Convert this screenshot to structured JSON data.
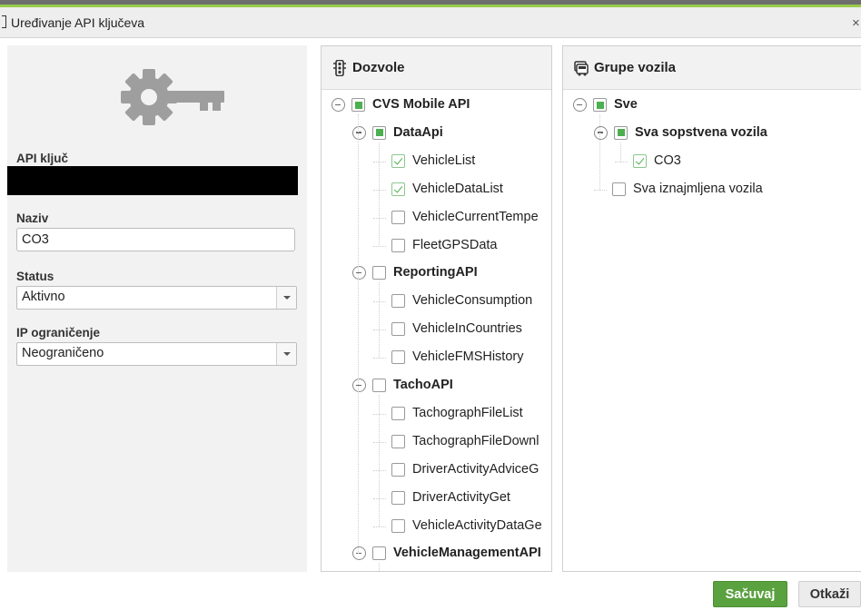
{
  "dialog": {
    "title": "Uređivanje API ključeva",
    "close_glyph": "×"
  },
  "form": {
    "api_key_label": "API ključ",
    "name_label": "Naziv",
    "name_value": "CO3",
    "status_label": "Status",
    "status_value": "Aktivno",
    "ip_label": "IP ograničenje",
    "ip_value": "Neograničeno"
  },
  "permissions": {
    "title": "Dozvole",
    "icon": "traffic-light-icon",
    "nodes": [
      {
        "label": "CVS Mobile API",
        "level": 0,
        "state": "partial",
        "expandable": true,
        "bold": true
      },
      {
        "label": "DataApi",
        "level": 1,
        "state": "partial",
        "expandable": true,
        "bold": true
      },
      {
        "label": "VehicleList",
        "level": 2,
        "state": "checked",
        "expandable": false,
        "bold": false
      },
      {
        "label": "VehicleDataList",
        "level": 2,
        "state": "checked",
        "expandable": false,
        "bold": false
      },
      {
        "label": "VehicleCurrentTempe",
        "level": 2,
        "state": "unchecked",
        "expandable": false,
        "bold": false
      },
      {
        "label": "FleetGPSData",
        "level": 2,
        "state": "unchecked",
        "expandable": false,
        "bold": false
      },
      {
        "label": "ReportingAPI",
        "level": 1,
        "state": "unchecked",
        "expandable": true,
        "bold": true
      },
      {
        "label": "VehicleConsumption",
        "level": 2,
        "state": "unchecked",
        "expandable": false,
        "bold": false
      },
      {
        "label": "VehicleInCountries",
        "level": 2,
        "state": "unchecked",
        "expandable": false,
        "bold": false
      },
      {
        "label": "VehicleFMSHistory",
        "level": 2,
        "state": "unchecked",
        "expandable": false,
        "bold": false
      },
      {
        "label": "TachoAPI",
        "level": 1,
        "state": "unchecked",
        "expandable": true,
        "bold": true
      },
      {
        "label": "TachographFileList",
        "level": 2,
        "state": "unchecked",
        "expandable": false,
        "bold": false
      },
      {
        "label": "TachographFileDownl",
        "level": 2,
        "state": "unchecked",
        "expandable": false,
        "bold": false
      },
      {
        "label": "DriverActivityAdviceG",
        "level": 2,
        "state": "unchecked",
        "expandable": false,
        "bold": false
      },
      {
        "label": "DriverActivityGet",
        "level": 2,
        "state": "unchecked",
        "expandable": false,
        "bold": false
      },
      {
        "label": "VehicleActivityDataGe",
        "level": 2,
        "state": "unchecked",
        "expandable": false,
        "bold": false
      },
      {
        "label": "VehicleManagementAPI",
        "level": 1,
        "state": "unchecked",
        "expandable": true,
        "bold": true
      }
    ]
  },
  "vehicle_groups": {
    "title": "Grupe vozila",
    "icon": "vehicle-groups-icon",
    "nodes": [
      {
        "label": "Sve",
        "level": 0,
        "state": "partial",
        "expandable": true,
        "bold": true
      },
      {
        "label": "Sva sopstvena vozila",
        "level": 1,
        "state": "partial",
        "expandable": true,
        "bold": true
      },
      {
        "label": "CO3",
        "level": 2,
        "state": "checked",
        "expandable": false,
        "bold": false
      },
      {
        "label": "Sva iznajmljena vozila",
        "level": 1,
        "state": "unchecked",
        "expandable": false,
        "bold": false
      }
    ]
  },
  "footer": {
    "save_label": "Sačuvaj",
    "cancel_label": "Otkaži"
  },
  "colors": {
    "accent_green": "#5aa13f",
    "check_green": "#4caf50",
    "gear_gray": "#9e9e9e"
  }
}
